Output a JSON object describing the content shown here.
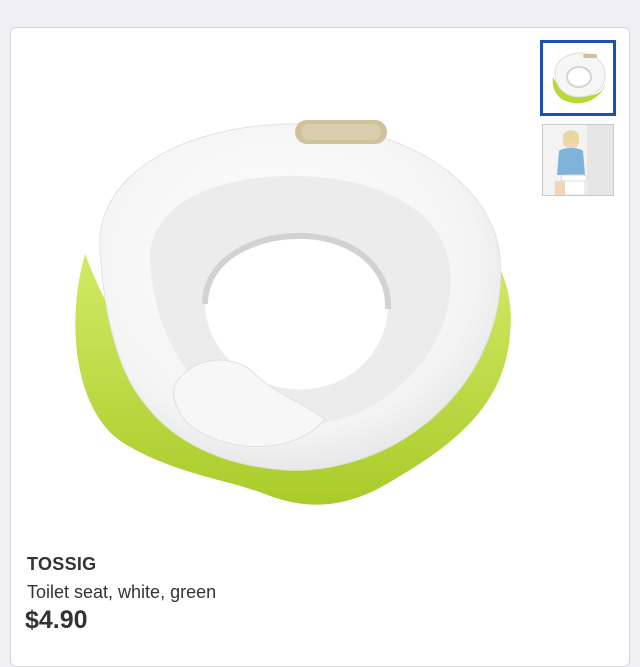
{
  "product": {
    "name": "TOSSIG",
    "description": "Toilet seat, white, green",
    "price": "$4.90"
  },
  "gallery": {
    "main_image": "toilet-seat-product-photo",
    "thumbnails": [
      {
        "image": "toilet-seat-thumbnail",
        "selected": true
      },
      {
        "image": "child-on-toilet-thumbnail",
        "selected": false
      }
    ]
  },
  "colors": {
    "seat_white": "#ffffff",
    "base_green": "#b8d832",
    "selected_border": "#1b4fb3",
    "text": "#333333"
  }
}
